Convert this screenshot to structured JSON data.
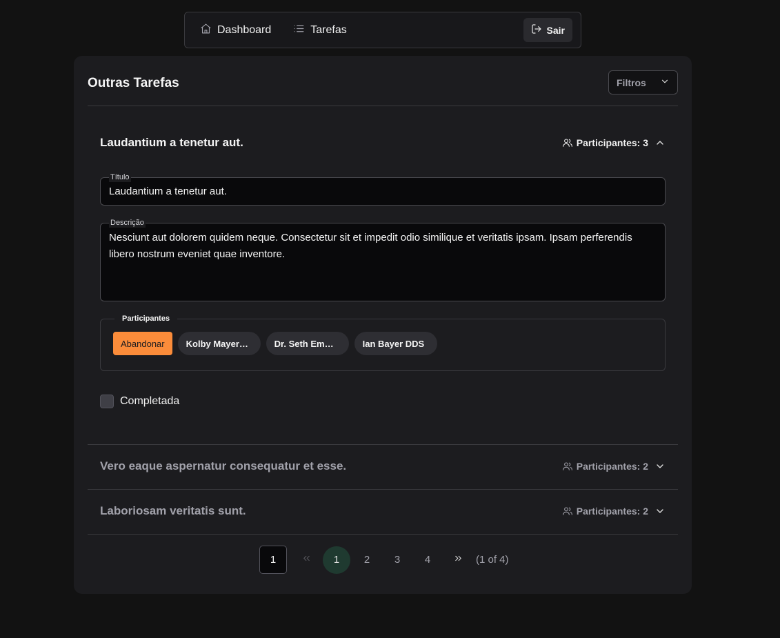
{
  "navbar": {
    "links": [
      {
        "label": "Dashboard",
        "icon": "home-icon"
      },
      {
        "label": "Tarefas",
        "icon": "list-icon"
      }
    ],
    "logout_label": "Sair"
  },
  "card": {
    "title": "Outras Tarefas",
    "filter_label": "Filtros"
  },
  "tasks": [
    {
      "title": "Laudantium a tenetur aut.",
      "participants_label": "Participantes: 3",
      "expanded": true,
      "fields": {
        "title_label": "Título",
        "title_value": "Laudantium a tenetur aut.",
        "description_label": "Descrição",
        "description_value": "Nesciunt aut dolorem quidem neque. Consectetur sit et impedit odio similique et veritatis ipsam. Ipsam perferendis libero nostrum eveniet quae inventore.",
        "participants_legend": "Participantes",
        "leave_button": "Abandonar",
        "participants": [
          "Kolby Mayer…",
          "Dr. Seth Em…",
          "Ian Bayer DDS"
        ],
        "completed_label": "Completada",
        "completed": false
      }
    },
    {
      "title": "Vero eaque aspernatur consequatur et esse.",
      "participants_label": "Participantes: 2",
      "expanded": false
    },
    {
      "title": "Laboriosam veritatis sunt.",
      "participants_label": "Participantes: 2",
      "expanded": false
    }
  ],
  "pagination": {
    "input_value": "1",
    "pages": [
      "1",
      "2",
      "3",
      "4"
    ],
    "current_page": "1",
    "report": "(1 of 4)"
  },
  "colors": {
    "background": "#121212",
    "card": "#1c1c1f",
    "accent": "#fb8c3a",
    "active_page": "#1f3a30"
  }
}
